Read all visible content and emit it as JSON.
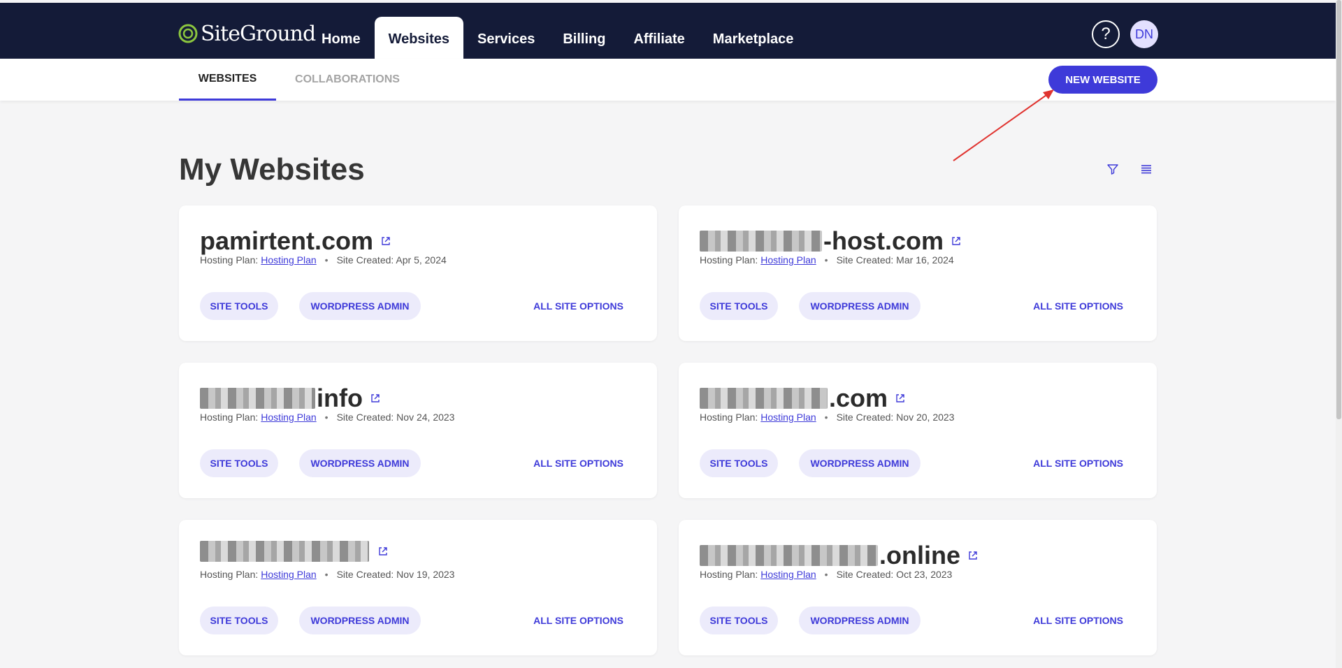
{
  "brand": {
    "name": "SiteGround"
  },
  "nav": {
    "items": [
      {
        "label": "Home",
        "active": false
      },
      {
        "label": "Websites",
        "active": true
      },
      {
        "label": "Services",
        "active": false
      },
      {
        "label": "Billing",
        "active": false
      },
      {
        "label": "Affiliate",
        "active": false
      },
      {
        "label": "Marketplace",
        "active": false
      }
    ],
    "help_label": "?",
    "avatar_initials": "DN"
  },
  "subnav": {
    "tabs": [
      {
        "label": "WEBSITES",
        "active": true
      },
      {
        "label": "COLLABORATIONS",
        "active": false
      }
    ],
    "new_website_label": "NEW WEBSITE"
  },
  "page": {
    "title": "My Websites"
  },
  "toolbar_icons": [
    "filter-icon",
    "list-view-icon"
  ],
  "cards": [
    {
      "domain_visible": "pamirtent.com",
      "redacted": false,
      "plan_label": "Hosting Plan:",
      "plan_link": "Hosting Plan",
      "created": "Site Created: Apr 5, 2024"
    },
    {
      "domain_visible": "-host.com",
      "redacted": true,
      "plan_label": "Hosting Plan:",
      "plan_link": "Hosting Plan",
      "created": "Site Created: Mar 16, 2024"
    },
    {
      "domain_visible": "info",
      "redacted": true,
      "plan_label": "Hosting Plan:",
      "plan_link": "Hosting Plan",
      "created": "Site Created: Nov 24, 2023"
    },
    {
      "domain_visible": ".com",
      "redacted": true,
      "plan_label": "Hosting Plan:",
      "plan_link": "Hosting Plan",
      "created": "Site Created: Nov 20, 2023"
    },
    {
      "domain_visible": "",
      "redacted": true,
      "plan_label": "Hosting Plan:",
      "plan_link": "Hosting Plan",
      "created": "Site Created: Nov 19, 2023"
    },
    {
      "domain_visible": ".online",
      "redacted": true,
      "plan_label": "Hosting Plan:",
      "plan_link": "Hosting Plan",
      "created": "Site Created: Oct 23, 2023"
    }
  ],
  "card_actions": {
    "site_tools": "SITE TOOLS",
    "wordpress_admin": "WORDPRESS ADMIN",
    "all_site_options": "ALL SITE OPTIONS"
  },
  "colors": {
    "topbar": "#141b38",
    "accent": "#3e3ad9",
    "pill_bg": "#ecebfb",
    "page_bg": "#f5f5f6"
  }
}
